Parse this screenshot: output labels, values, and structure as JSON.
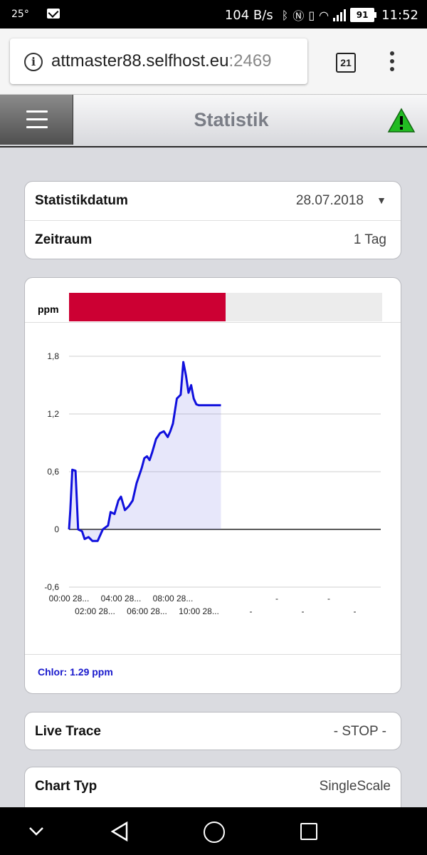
{
  "statusbar": {
    "temperature": "25°",
    "net_speed": "104 B/s",
    "battery": "91",
    "time": "11:52"
  },
  "browser": {
    "url_main": "attmaster88.selfhost.eu",
    "url_port": ":2469",
    "tab_count": "21"
  },
  "header": {
    "title": "Statistik"
  },
  "settings": {
    "date_label": "Statistikdatum",
    "date_value": "28.07.2018",
    "period_label": "Zeitraum",
    "period_value": "1 Tag"
  },
  "chart_data": {
    "type": "line",
    "unit_label": "ppm",
    "progress_fraction": 0.5,
    "y_ticks": [
      "1,8",
      "1,2",
      "0,6",
      "0",
      "-0,6"
    ],
    "ylim": [
      -0.6,
      1.8
    ],
    "x_ticks_top": [
      "00:00 28...",
      "04:00 28...",
      "08:00 28...",
      "-",
      "-"
    ],
    "x_ticks_bottom": [
      "02:00 28...",
      "06:00 28...",
      "10:00 28...",
      "-",
      "-",
      "-"
    ],
    "series": [
      {
        "name": "Chlor",
        "x": [
          0.0,
          0.1,
          0.25,
          0.5,
          0.7,
          1.0,
          1.2,
          1.5,
          1.8,
          2.2,
          2.6,
          3.0,
          3.2,
          3.5,
          3.8,
          4.0,
          4.3,
          4.6,
          4.9,
          5.2,
          5.4,
          5.6,
          5.8,
          6.0,
          6.2,
          6.4,
          6.7,
          7.0,
          7.3,
          7.6,
          7.8,
          8.0,
          8.3,
          8.6,
          8.8,
          9.0,
          9.2,
          9.4,
          9.6,
          9.8,
          10.0,
          10.3,
          10.6,
          10.8,
          11.0,
          11.2,
          11.5,
          11.7
        ],
        "y": [
          0.0,
          0.2,
          0.62,
          0.61,
          0.0,
          -0.02,
          -0.1,
          -0.08,
          -0.12,
          -0.12,
          0.0,
          0.04,
          0.18,
          0.16,
          0.3,
          0.34,
          0.2,
          0.24,
          0.3,
          0.48,
          0.56,
          0.64,
          0.74,
          0.76,
          0.72,
          0.8,
          0.94,
          1.0,
          1.02,
          0.96,
          1.02,
          1.1,
          1.36,
          1.4,
          1.74,
          1.6,
          1.42,
          1.5,
          1.36,
          1.3,
          1.29,
          1.29,
          1.29,
          1.29,
          1.29,
          1.29,
          1.29,
          1.29
        ]
      }
    ],
    "reading_label": "Chlor: 1.29 ppm"
  },
  "livetrace": {
    "label": "Live Trace",
    "value": "- STOP -"
  },
  "charttype": {
    "label": "Chart Typ",
    "value": "SingleScale"
  }
}
